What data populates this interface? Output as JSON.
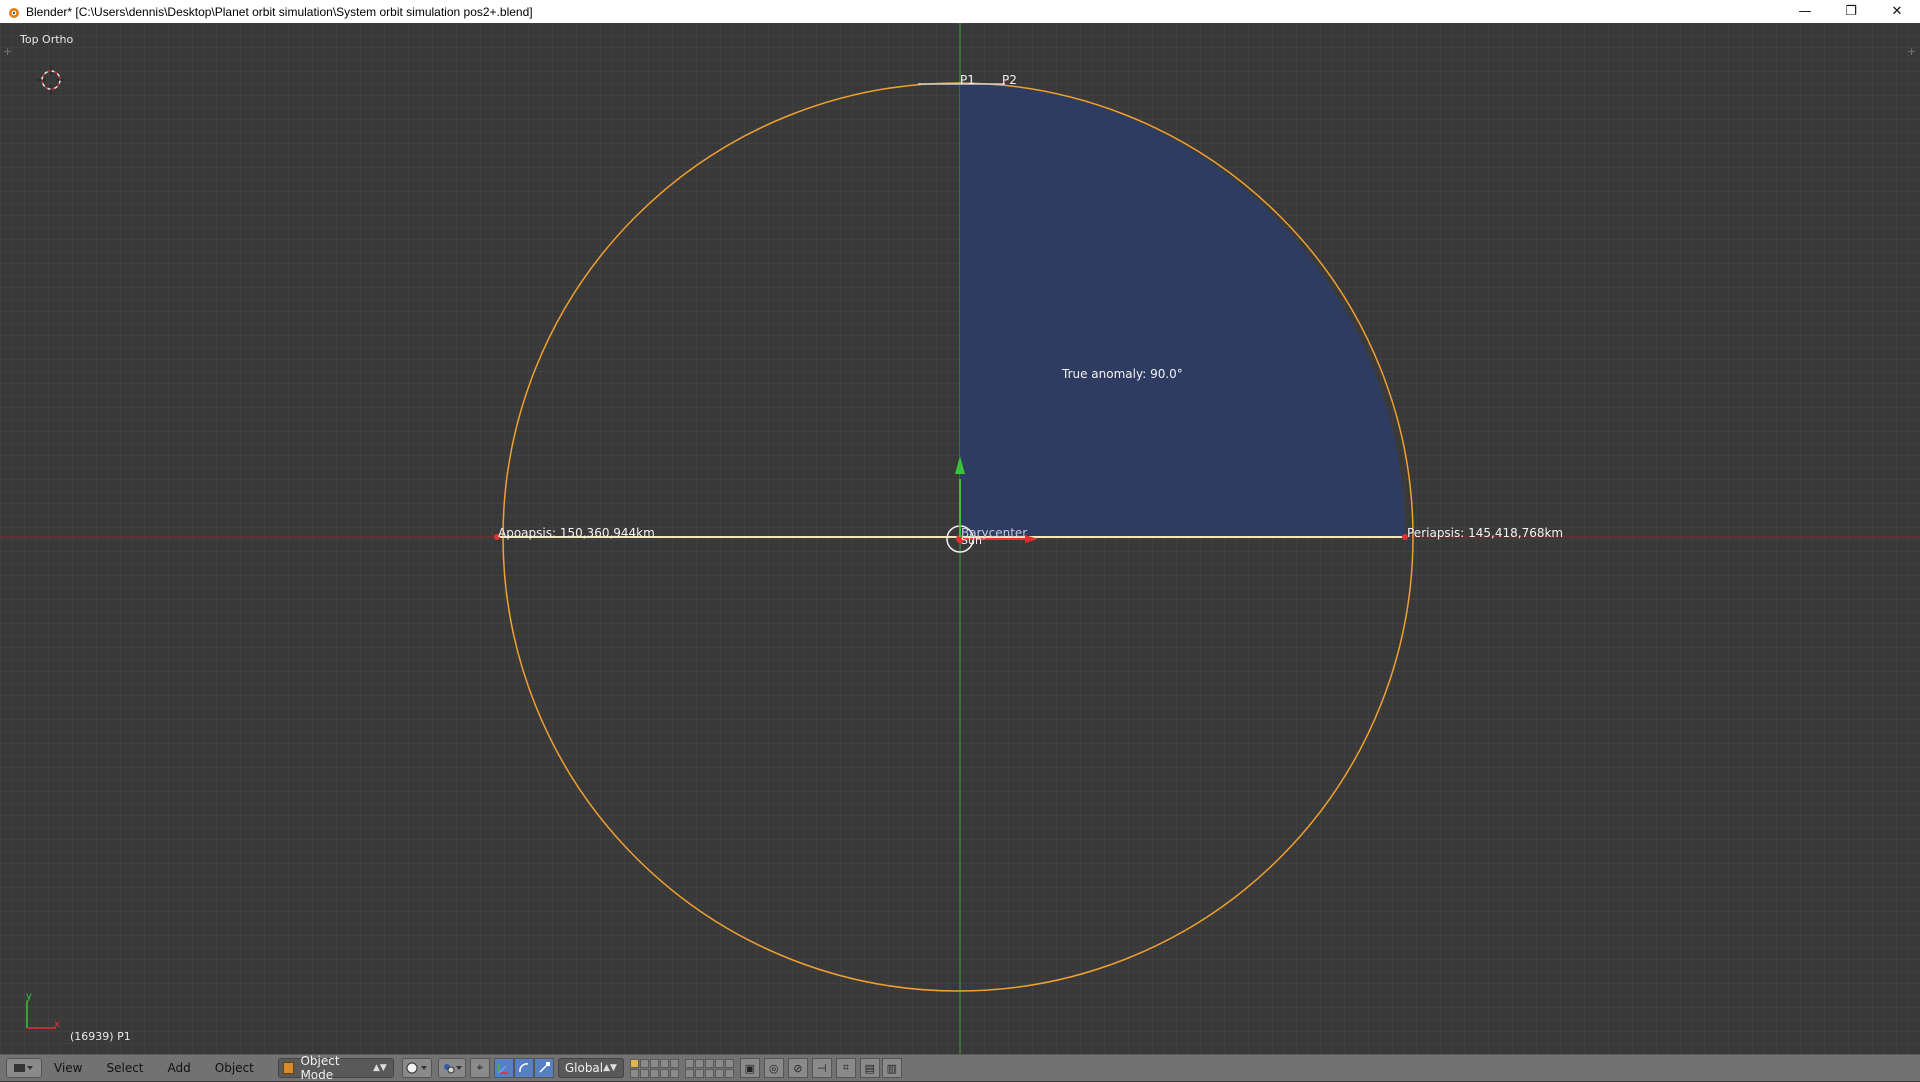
{
  "window": {
    "title": "Blender* [C:\\Users\\dennis\\Desktop\\Planet orbit simulation\\System orbit simulation pos2+.blend]",
    "minimize_glyph": "—",
    "restore_glyph": "❐",
    "close_glyph": "✕"
  },
  "viewport": {
    "view_label": "Top Ortho",
    "frame_info": "(16939) P1",
    "axis_y_label": "y",
    "axis_x_label": "x",
    "labels": {
      "p1": "P1",
      "p2": "P2",
      "true_anomaly": "True anomaly: 90.0°",
      "apoapsis": "Apoapsis: 150,360,944km",
      "periapsis": "Periapsis: 145,418,768km",
      "barycenter": "Barycenter",
      "sun": "Sun"
    },
    "colors": {
      "orbit": "#f0a030",
      "sector": "#2e3c62",
      "x_axis": "#8a2b2b",
      "y_axis": "#3aa03a",
      "apsis_line": "#f5e6b8",
      "apsis_marker": "#e03030"
    }
  },
  "header": {
    "menus": [
      "View",
      "Select",
      "Add",
      "Object"
    ],
    "mode": "Object Mode",
    "orientation": "Global",
    "icons": [
      "editor-type-icon",
      "shading-sphere-icon",
      "pivot-icon",
      "manipulator-icon",
      "translate-icon",
      "rotate-icon",
      "scale-icon"
    ]
  }
}
